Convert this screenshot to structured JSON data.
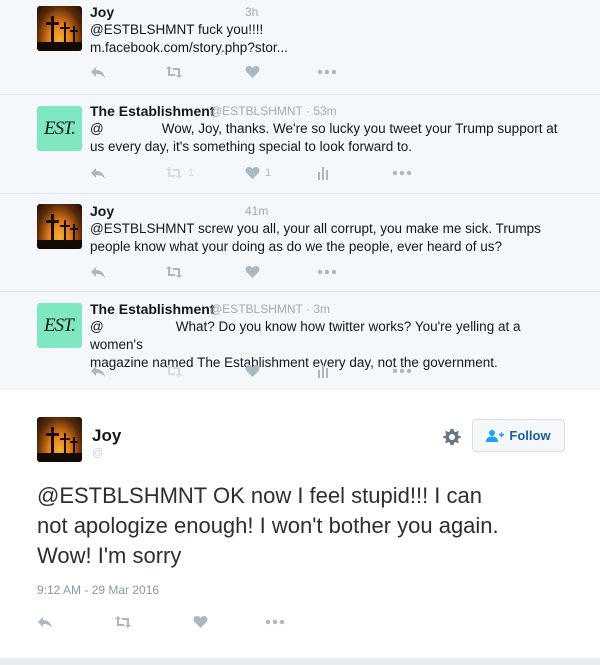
{
  "tweets": [
    {
      "name": "Joy",
      "handle": "",
      "time": "3h",
      "line1": "@ESTBLSHMNT fuck you!!!!",
      "line2": "m.facebook.com/story.php?stor...",
      "avatar": "joy-crosses-avatar"
    },
    {
      "name": "The Establishment",
      "handle": "@ESTBLSHMNT",
      "time": "· 53m",
      "mention": "@",
      "line1": "Wow, Joy, thanks. We're so lucky you tweet your Trump support at",
      "line2": "us every day, it's something special to look forward to.",
      "retweet_count": "1",
      "like_count": "1",
      "avatar": "establishment-logo",
      "logo_text": "EST."
    },
    {
      "name": "Joy",
      "handle": "",
      "time": "41m",
      "line1": "@ESTBLSHMNT screw you all, your all corrupt, you make me sick.  Trumps",
      "line2": "people know what your doing as do we the people, ever heard of us?",
      "avatar": "joy-crosses-avatar"
    },
    {
      "name": "The Establishment",
      "handle": "@ESTBLSHMNT",
      "time": "· 3m",
      "mention": "@",
      "line1": "What? Do you know how twitter works? You're yelling at a women's",
      "line2": "magazine named The Establishment every day, not the government.",
      "avatar": "establishment-logo",
      "logo_text": "EST."
    }
  ],
  "main_tweet": {
    "name": "Joy",
    "handle": "@",
    "text_line1": "@ESTBLSHMNT OK now I feel stupid!!!  I can",
    "text_line2": "not apologize enough!  I won't bother you again.",
    "text_line3": "Wow!  I'm sorry",
    "timestamp": "9:12 AM - 29 Mar 2016",
    "follow_label": "Follow"
  },
  "colors": {
    "icon": "#aab8c2",
    "timeline_bg": "#f5f8fa",
    "logo_bg": "#7fe8c0",
    "follow_text": "#1a5f9e"
  }
}
